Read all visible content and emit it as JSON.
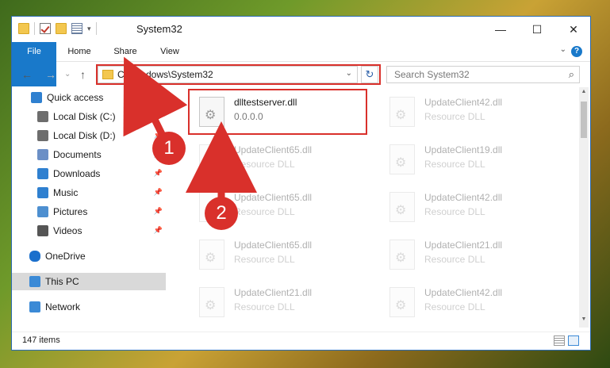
{
  "window": {
    "title": "System32",
    "controls": {
      "minimize": "—",
      "maximize": "☐",
      "close": "✕"
    }
  },
  "ribbon": {
    "tabs": [
      "File",
      "Home",
      "Share",
      "View"
    ],
    "help": "?"
  },
  "address": {
    "path": "C:\\Windows\\System32",
    "refresh": "↻",
    "dropdown": "⌄"
  },
  "search": {
    "placeholder": "Search System32",
    "icon": "⌕"
  },
  "nav": {
    "back": "←",
    "forward": "→",
    "up": "↑",
    "recent": "⌄"
  },
  "sidebar": {
    "items": [
      {
        "label": "Quick access",
        "icon": "star-icon"
      },
      {
        "label": "Local Disk (C:)",
        "icon": "drive-icon",
        "pin": true
      },
      {
        "label": "Local Disk (D:)",
        "icon": "drive-icon",
        "pin": true
      },
      {
        "label": "Documents",
        "icon": "documents-icon",
        "pin": true
      },
      {
        "label": "Downloads",
        "icon": "download-icon",
        "pin": true
      },
      {
        "label": "Music",
        "icon": "music-icon",
        "pin": true
      },
      {
        "label": "Pictures",
        "icon": "pictures-icon",
        "pin": true
      },
      {
        "label": "Videos",
        "icon": "videos-icon",
        "pin": true
      },
      {
        "label": "OneDrive",
        "icon": "cloud-icon"
      },
      {
        "label": "This PC",
        "icon": "computer-icon",
        "selected": true
      },
      {
        "label": "Network",
        "icon": "network-icon"
      }
    ]
  },
  "files": [
    {
      "name": "dlltestserver.dll",
      "desc": "0.0.0.0",
      "highlighted": true
    },
    {
      "name": "UpdateClient42.dll",
      "desc": "Resource DLL"
    },
    {
      "name": "UpdateClient65.dll",
      "desc": "Resource DLL"
    },
    {
      "name": "UpdateClient19.dll",
      "desc": "Resource DLL"
    },
    {
      "name": "UpdateClient65.dll",
      "desc": "Resource DLL"
    },
    {
      "name": "UpdateClient42.dll",
      "desc": "Resource DLL"
    },
    {
      "name": "UpdateClient65.dll",
      "desc": "Resource DLL"
    },
    {
      "name": "UpdateClient21.dll",
      "desc": "Resource DLL"
    },
    {
      "name": "UpdateClient21.dll",
      "desc": "Resource DLL"
    },
    {
      "name": "UpdateClient42.dll",
      "desc": "Resource DLL"
    }
  ],
  "status": {
    "count": "147 items"
  },
  "annotations": {
    "badge1": "1",
    "badge2": "2",
    "color": "#d9302b"
  }
}
